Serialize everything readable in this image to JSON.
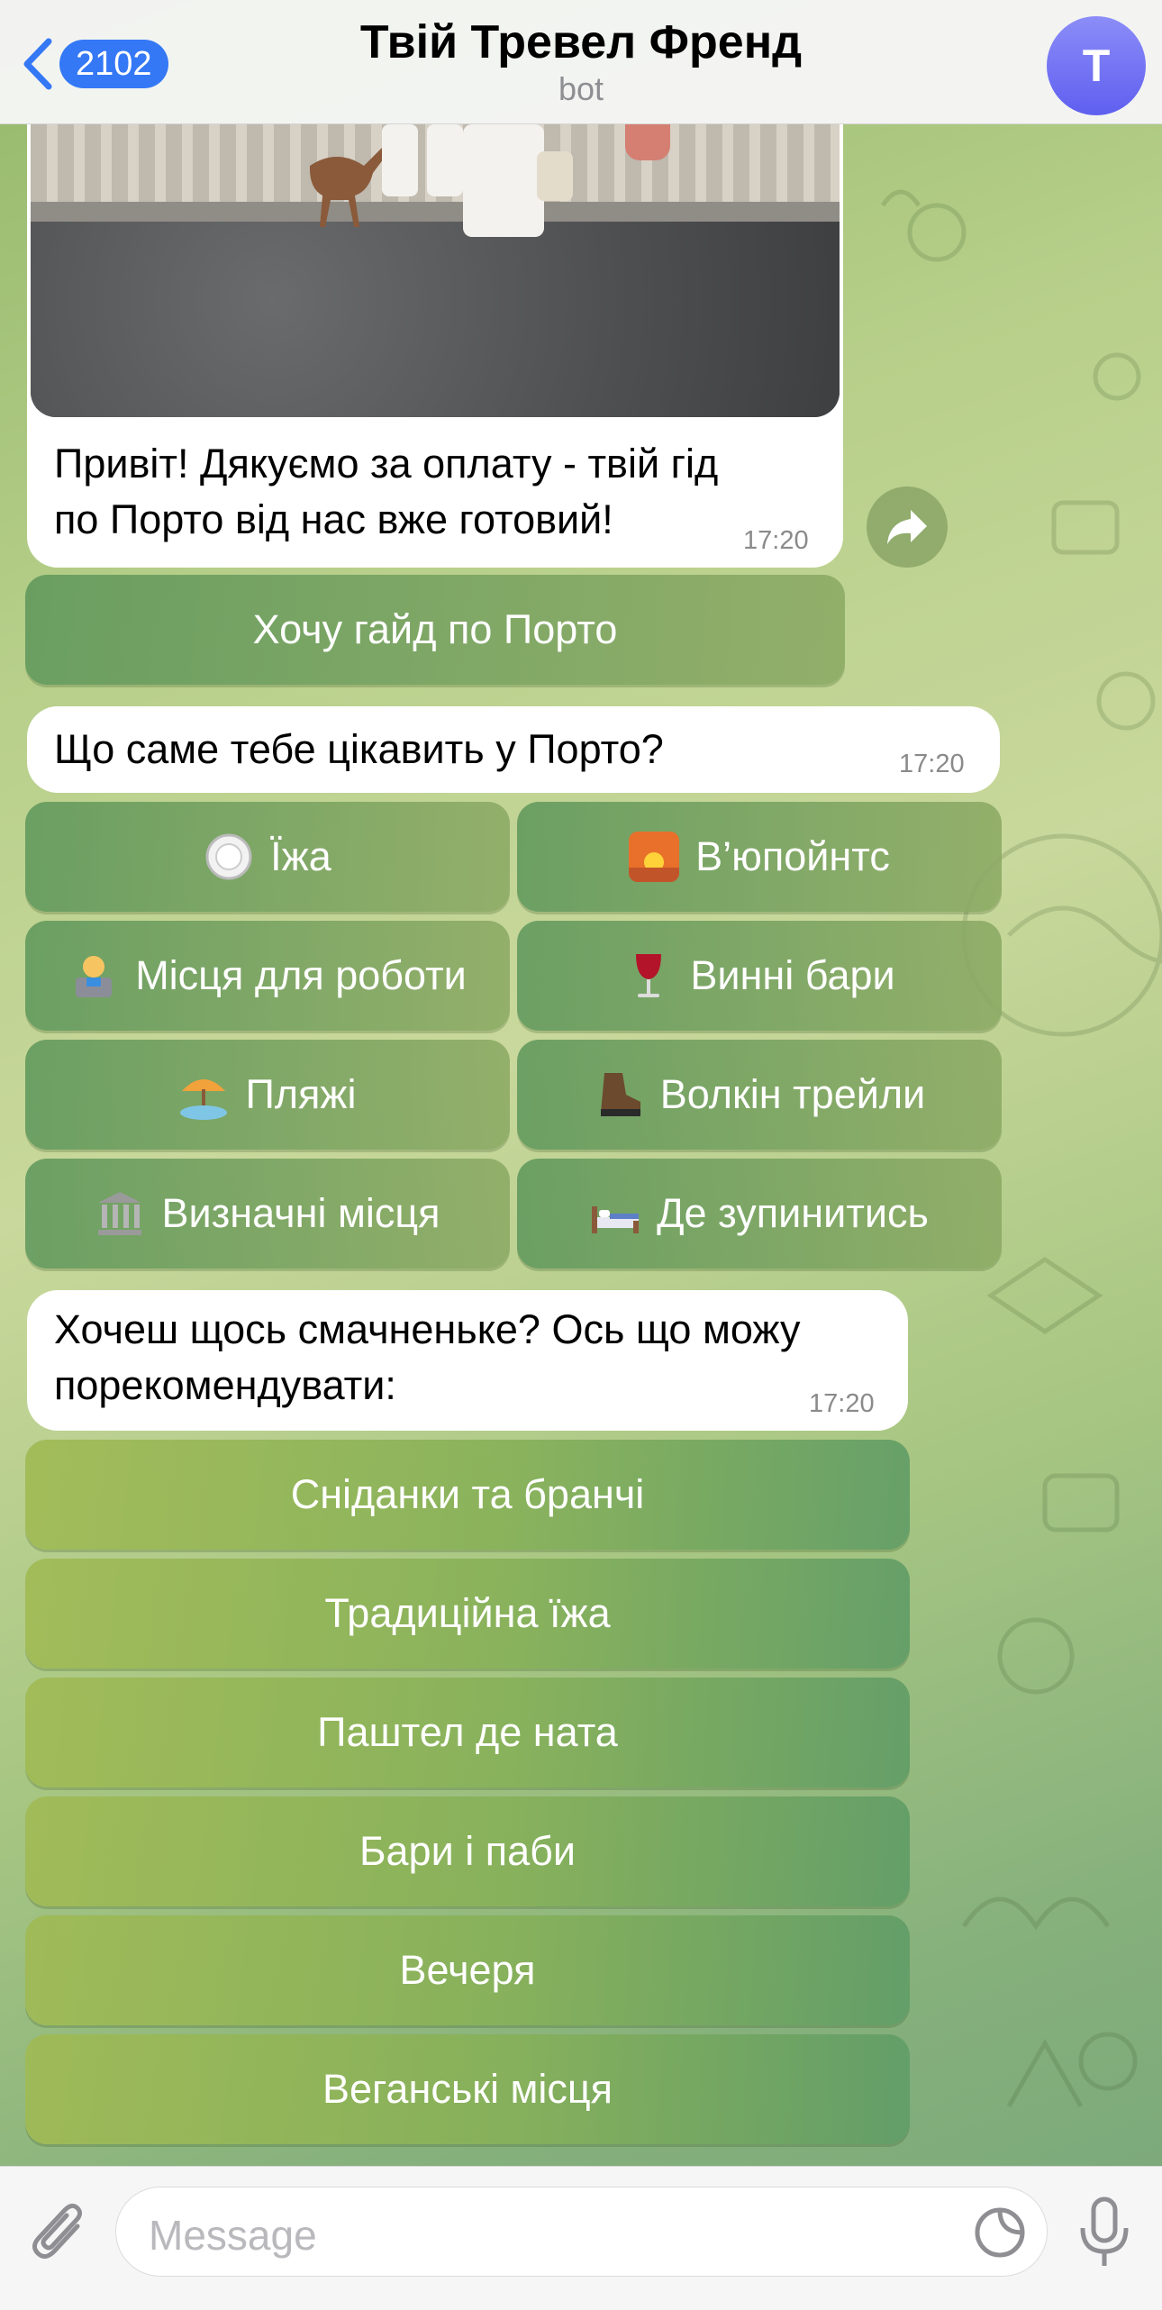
{
  "header": {
    "back_count": "2102",
    "title": "Твій Тревел Френд",
    "subtitle": "bot",
    "avatar_letter": "Т"
  },
  "messages": [
    {
      "text_line1": "Привіт! Дякуємо за оплату - твій гід",
      "text_line2": "по Порто від нас вже готовий!",
      "time": "17:20"
    },
    {
      "text_line1": "Що саме тебе цікавить у Порто?",
      "time": "17:20"
    },
    {
      "text_line1": "Хочеш щось смачненьке? Ось що можу",
      "text_line2": "порекомендувати:",
      "time": "17:20"
    }
  ],
  "guide_button": "Хочу гайд по Порто",
  "category_buttons": [
    {
      "label": "Їжа",
      "icon": "plate-icon"
    },
    {
      "label": "В’юпойнтс",
      "icon": "sunset-icon"
    },
    {
      "label": "Місця для роботи",
      "icon": "laptop-worker-icon"
    },
    {
      "label": "Винні бари",
      "icon": "wine-glass-icon"
    },
    {
      "label": "Пляжі",
      "icon": "beach-umbrella-icon"
    },
    {
      "label": "Волкін трейли",
      "icon": "hiking-boot-icon"
    },
    {
      "label": "Визначні місця",
      "icon": "classical-building-icon"
    },
    {
      "label": "Де зупинитись",
      "icon": "bed-icon"
    }
  ],
  "food_buttons": [
    "Сніданки та бранчі",
    "Традиційна їжа",
    "Паштел де ната",
    "Бари і паби",
    "Вечеря",
    "Веганські місця"
  ],
  "input": {
    "placeholder": "Message"
  },
  "colors": {
    "accent": "#3478f6",
    "avatar_top": "#8c8df8",
    "avatar_bottom": "#5f5ff0",
    "button_green": "#6a9c60"
  }
}
